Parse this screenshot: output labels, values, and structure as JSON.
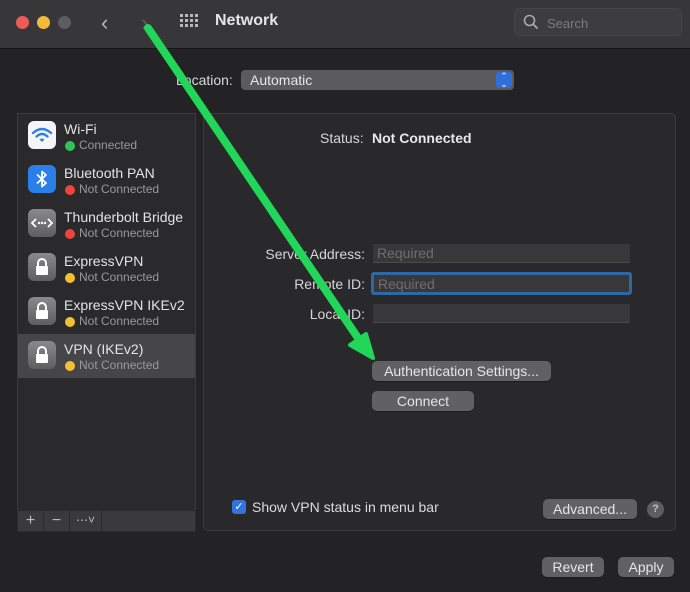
{
  "window": {
    "title": "Network",
    "search_placeholder": "Search"
  },
  "location": {
    "label": "Location:",
    "value": "Automatic"
  },
  "services": [
    {
      "name": "Wi-Fi",
      "status": "Connected",
      "status_color": "#31c553",
      "icon": "wifi-icon"
    },
    {
      "name": "Bluetooth PAN",
      "status": "Not Connected",
      "status_color": "#f0433a",
      "icon": "bluetooth-icon"
    },
    {
      "name": "Thunderbolt Bridge",
      "status": "Not Connected",
      "status_color": "#f0433a",
      "icon": "thunderbolt-bridge-icon"
    },
    {
      "name": "ExpressVPN",
      "status": "Not Connected",
      "status_color": "#f6c033",
      "icon": "lock-icon"
    },
    {
      "name": "ExpressVPN IKEv2",
      "status": "Not Connected",
      "status_color": "#f6c033",
      "icon": "lock-icon"
    },
    {
      "name": "VPN (IKEv2)",
      "status": "Not Connected",
      "status_color": "#f6c033",
      "icon": "lock-icon",
      "selected": true
    }
  ],
  "sidebar_tools": {
    "add": "+",
    "remove": "−",
    "action": "⋯˅"
  },
  "detail": {
    "status_label": "Status:",
    "status_value": "Not Connected",
    "fields": [
      {
        "label": "Server Address:",
        "value": "",
        "placeholder": "Required"
      },
      {
        "label": "Remote ID:",
        "value": "",
        "placeholder": "Required",
        "focused": true
      },
      {
        "label": "Local ID:",
        "value": "",
        "placeholder": ""
      }
    ],
    "auth_button": "Authentication Settings...",
    "connect_button": "Connect",
    "show_status_label": "Show VPN status in menu bar",
    "show_status_checked": true,
    "advanced_button": "Advanced...",
    "help": "?"
  },
  "footer": {
    "revert": "Revert",
    "apply": "Apply"
  },
  "annotation": {
    "arrow_color": "#22d65a"
  }
}
